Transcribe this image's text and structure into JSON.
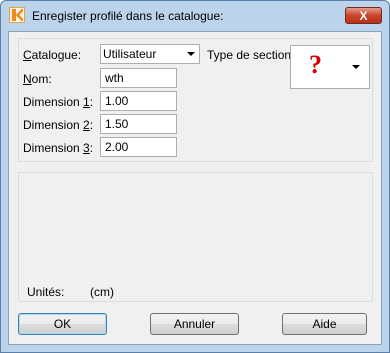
{
  "window": {
    "title": "Enregister profilé dans le catalogue:",
    "close_symbol": "X",
    "app_icon": "k-logo-icon"
  },
  "form": {
    "catalogue": {
      "label_pre": "",
      "label_key": "C",
      "label_post": "atalogue:",
      "value": "Utilisateur"
    },
    "section_type": {
      "label": "Type de section:",
      "value_symbol": "?"
    },
    "nom": {
      "label_pre": "",
      "label_key": "N",
      "label_post": "om:",
      "value": "wth"
    },
    "dimensions": [
      {
        "label_pre": "Dimension ",
        "label_key": "1",
        "label_post": ":",
        "value": "1.00"
      },
      {
        "label_pre": "Dimension ",
        "label_key": "2",
        "label_post": ":",
        "value": "1.50"
      },
      {
        "label_pre": "Dimension ",
        "label_key": "3",
        "label_post": ":",
        "value": "2.00"
      }
    ]
  },
  "units": {
    "label": "Unités:",
    "value": "(cm)"
  },
  "buttons": {
    "ok": "OK",
    "cancel": "Annuler",
    "help": "Aide"
  }
}
